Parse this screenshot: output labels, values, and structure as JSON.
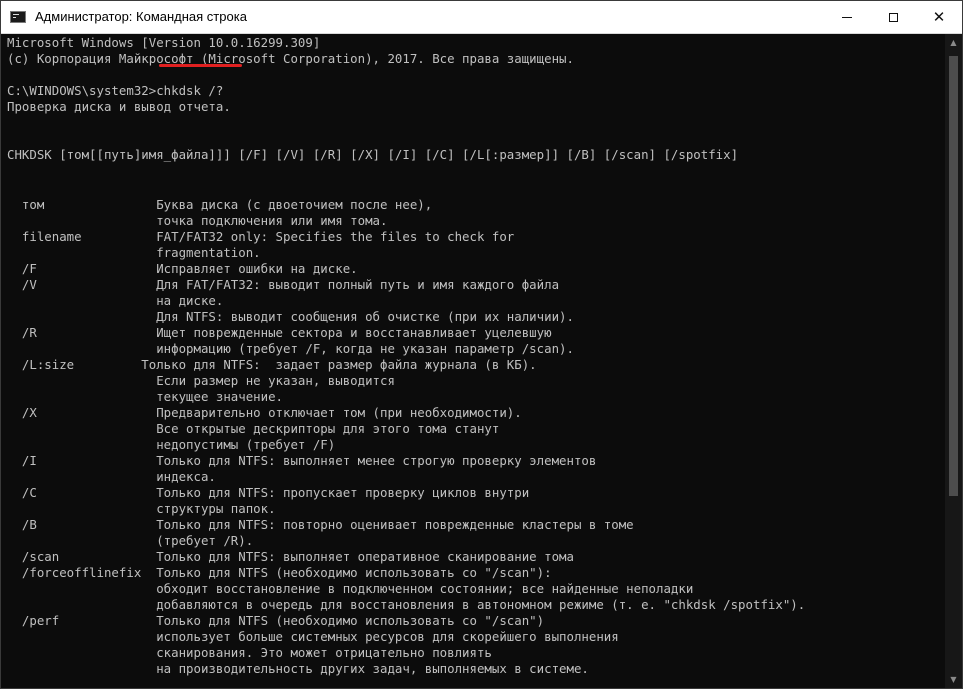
{
  "window": {
    "title": "Администратор: Командная строка",
    "icon": "cmd-icon"
  },
  "controls": {
    "minimize": "minimize-icon",
    "maximize": "maximize-icon",
    "close": "✕"
  },
  "console": {
    "lines": [
      "Microsoft Windows [Version 10.0.16299.309]",
      "(c) Корпорация Майкрософт (Microsoft Corporation), 2017. Все права защищены.",
      "",
      "C:\\WINDOWS\\system32>chkdsk /?",
      "Проверка диска и вывод отчета.",
      "",
      "",
      "CHKDSK [том[[путь]имя_файла]]] [/F] [/V] [/R] [/X] [/I] [/C] [/L[:размер]] [/B] [/scan] [/spotfix]",
      "",
      "",
      "  том               Буква диска (с двоеточием после нее),",
      "                    точка подключения или имя тома.",
      "  filename          FAT/FAT32 only: Specifies the files to check for",
      "                    fragmentation.",
      "  /F                Исправляет ошибки на диске.",
      "  /V                Для FAT/FAT32: выводит полный путь и имя каждого файла",
      "                    на диске.",
      "                    Для NTFS: выводит сообщения об очистке (при их наличии).",
      "  /R                Ищет поврежденные сектора и восстанавливает уцелевшую",
      "                    информацию (требует /F, когда не указан параметр /scan).",
      "  /L:size         Только для NTFS:  задает размер файла журнала (в КБ).",
      "                    Если размер не указан, выводится",
      "                    текущее значение.",
      "  /X                Предварительно отключает том (при необходимости).",
      "                    Все открытые дескрипторы для этого тома станут",
      "                    недопустимы (требует /F)",
      "  /I                Только для NTFS: выполняет менее строгую проверку элементов",
      "                    индекса.",
      "  /C                Только для NTFS: пропускает проверку циклов внутри",
      "                    структуры папок.",
      "  /B                Только для NTFS: повторно оценивает поврежденные кластеры в томе",
      "                    (требует /R).",
      "  /scan             Только для NTFS: выполняет оперативное сканирование тома",
      "  /forceofflinefix  Только для NTFS (необходимо использовать со \"/scan\"):",
      "                    обходит восстановление в подключенном состоянии; все найденные неполадки",
      "                    добавляются в очередь для восстановления в автономном режиме (т. е. \"chkdsk /spotfix\").",
      "  /perf             Только для NTFS (необходимо использовать со \"/scan\")",
      "                    использует больше системных ресурсов для скорейшего выполнения",
      "                    сканирования. Это может отрицательно повлиять",
      "                    на производительность других задач, выполняемых в системе."
    ]
  },
  "colors": {
    "console_bg": "#0c0c0c",
    "console_fg": "#c0c0c0",
    "highlight": "#e02020"
  }
}
